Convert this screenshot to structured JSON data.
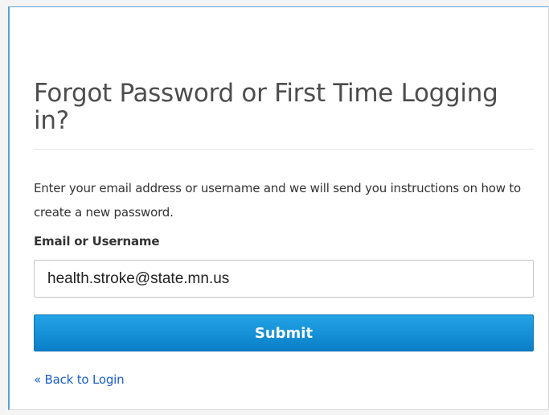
{
  "form": {
    "title": "Forgot Password or First Time Logging in?",
    "instructions": "Enter your email address or username and we will send you instructions on how to create a new password.",
    "field_label": "Email or Username",
    "field_value": "health.stroke@state.mn.us",
    "submit_label": "Submit",
    "back_link": "« Back to Login"
  },
  "colors": {
    "accent": "#0a7fc8",
    "link": "#1b5fc9",
    "card_border": "#5aa0d8"
  }
}
